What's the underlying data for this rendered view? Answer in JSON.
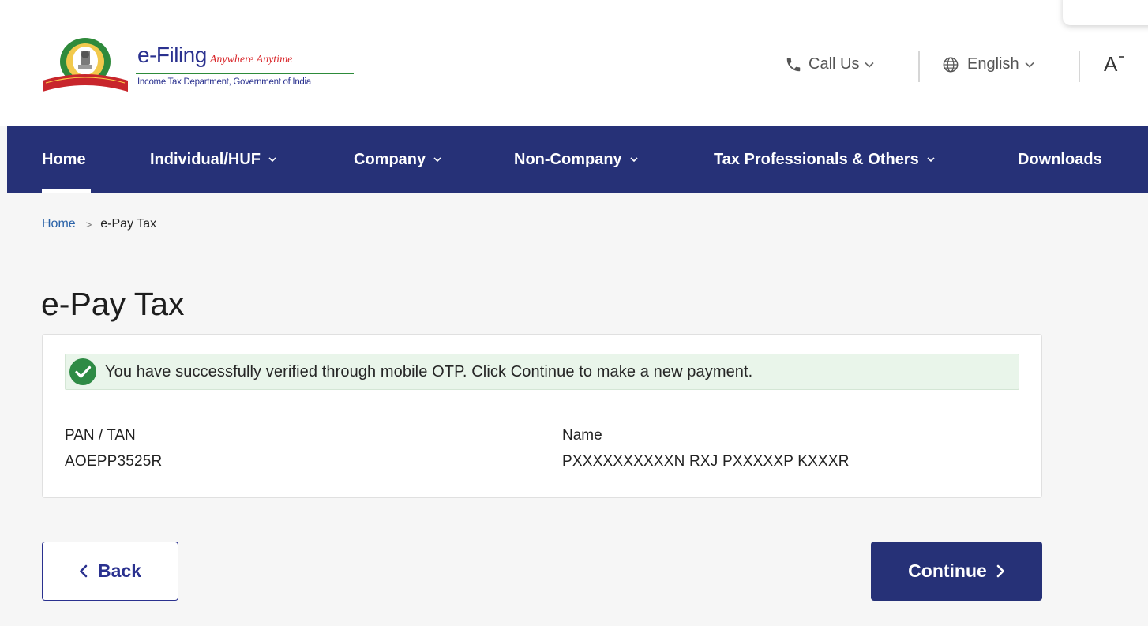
{
  "header": {
    "brand_title": "e-Filing",
    "brand_tagline": "Anywhere Anytime",
    "brand_subtitle": "Income Tax Department, Government of India",
    "call_us_label": "Call Us",
    "language_label": "English",
    "font_size_label": "A"
  },
  "nav": {
    "items": [
      {
        "label": "Home",
        "has_dropdown": false,
        "active": true
      },
      {
        "label": "Individual/HUF",
        "has_dropdown": true
      },
      {
        "label": "Company",
        "has_dropdown": true
      },
      {
        "label": "Non-Company",
        "has_dropdown": true
      },
      {
        "label": "Tax Professionals & Others",
        "has_dropdown": true
      },
      {
        "label": "Downloads",
        "has_dropdown": false
      }
    ]
  },
  "breadcrumb": {
    "home": "Home",
    "separator": ">",
    "current": "e-Pay Tax"
  },
  "page": {
    "title": "e-Pay Tax"
  },
  "card": {
    "alert_text": "You have successfully verified through mobile OTP. Click Continue to make a new payment.",
    "pan_label": "PAN / TAN",
    "pan_value": "AOEPP3525R",
    "name_label": "Name",
    "name_value": "PXXXXXXXXXXN RXJ PXXXXXP KXXXR"
  },
  "actions": {
    "back_label": "Back",
    "continue_label": "Continue"
  },
  "colors": {
    "nav_bg": "#263177",
    "brand_blue": "#2a318f",
    "link_blue": "#2a62a8",
    "success_green": "#2e8b45",
    "alert_bg": "#e9f5ea"
  },
  "icons": [
    "emblem-logo",
    "phone-icon",
    "globe-icon",
    "chevron-down-icon",
    "font-size-icon",
    "check-circle-icon",
    "chevron-left-icon",
    "chevron-right-icon"
  ]
}
